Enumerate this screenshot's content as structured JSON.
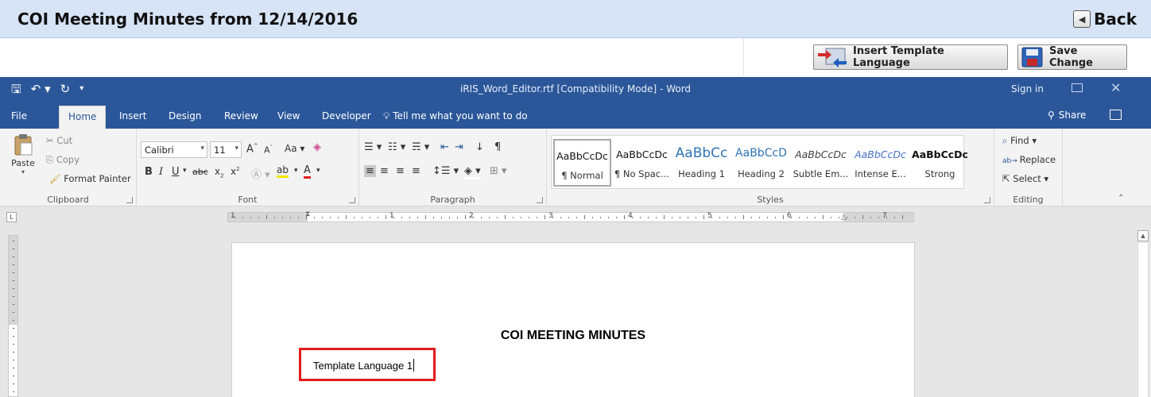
{
  "header": {
    "title": "COI Meeting Minutes from 12/14/2016",
    "back_label": "Back"
  },
  "actions": {
    "insert_template_label": "Insert Template Language",
    "save_change_label": "Save Change"
  },
  "word": {
    "doc_title": "iRIS_Word_Editor.rtf [Compatibility Mode] - Word",
    "sign_in": "Sign in",
    "share": "Share",
    "tabs": [
      "File",
      "Home",
      "Insert",
      "Design",
      "Review",
      "View",
      "Developer"
    ],
    "tell_me": "Tell me what you want to do",
    "clipboard": {
      "paste": "Paste",
      "cut": "Cut",
      "copy": "Copy",
      "format_painter": "Format Painter",
      "label": "Clipboard"
    },
    "font": {
      "name": "Calibri",
      "size": "11",
      "label": "Font"
    },
    "paragraph": {
      "label": "Paragraph"
    },
    "styles": {
      "label": "Styles",
      "items": [
        {
          "preview": "AaBbCcDc",
          "name": "¶ Normal"
        },
        {
          "preview": "AaBbCcDc",
          "name": "¶ No Spac..."
        },
        {
          "preview": "AaBbCc",
          "name": "Heading 1"
        },
        {
          "preview": "AaBbCcD",
          "name": "Heading 2"
        },
        {
          "preview": "AaBbCcDc",
          "name": "Subtle Em..."
        },
        {
          "preview": "AaBbCcDc",
          "name": "Intense E..."
        },
        {
          "preview": "AaBbCcDc",
          "name": "Strong"
        }
      ]
    },
    "editing": {
      "find": "Find",
      "replace": "Replace",
      "select": "Select",
      "label": "Editing"
    },
    "ruler_numbers": [
      "1",
      "1",
      "2",
      "3",
      "4",
      "5",
      "6",
      "7"
    ]
  },
  "document": {
    "heading": "COI MEETING MINUTES",
    "line": "Template Language 1"
  },
  "colors": {
    "word_blue": "#2b579a",
    "header_bg": "#d6e4f5",
    "highlight_red": "#e41b1b"
  }
}
